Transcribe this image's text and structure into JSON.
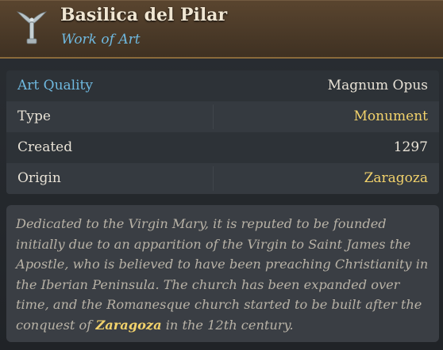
{
  "header": {
    "title": "Basilica del Pilar",
    "subtitle": "Work of Art",
    "icon": "wing-pillar-icon"
  },
  "properties": [
    {
      "label": "Art Quality",
      "value": "Magnum Opus"
    },
    {
      "label": "Type",
      "value": "Monument"
    },
    {
      "label": "Created",
      "value": "1297"
    },
    {
      "label": "Origin",
      "value": "Zaragoza"
    }
  ],
  "description": {
    "part1": "Dedicated to the Virgin Mary, it is reputed to be founded initially due to an apparition of the Virgin to Saint James the Apostle, who is believed to have been preaching Christianity in the Iberian Peninsula. The church has been expanded over time, and the Romanesque church started to be built after the conquest of ",
    "highlight": "Zaragoza",
    "part2": " in the 12th century."
  },
  "colors": {
    "header_bg": "#4b3a28",
    "accent_blue": "#6fb9e0",
    "accent_gold": "#f2d26b",
    "panel_bg": "#2d3237"
  }
}
